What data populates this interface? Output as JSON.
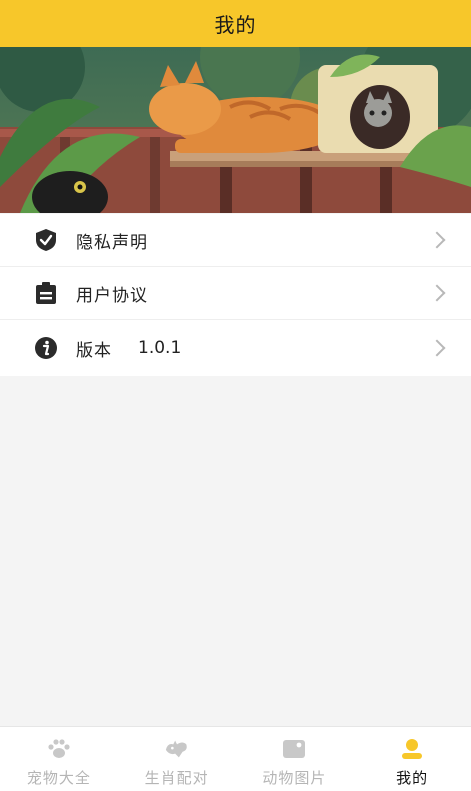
{
  "header": {
    "title": "我的"
  },
  "banner": {
    "alt": "cats-on-balcony-illustration"
  },
  "menu": {
    "items": [
      {
        "label": "隐私声明",
        "icon": "shield-check-icon"
      },
      {
        "label": "用户协议",
        "icon": "clipboard-icon"
      },
      {
        "label": "版本",
        "value": "1.0.1",
        "icon": "info-icon"
      }
    ]
  },
  "tabbar": {
    "tabs": [
      {
        "label": "宠物大全",
        "icon": "paw-icon",
        "active": false
      },
      {
        "label": "生肖配对",
        "icon": "zodiac-icon",
        "active": false
      },
      {
        "label": "动物图片",
        "icon": "picture-icon",
        "active": false
      },
      {
        "label": "我的",
        "icon": "user-icon",
        "active": true
      }
    ]
  },
  "colors": {
    "accent": "#f7c72a",
    "text": "#222222",
    "inactive_tab": "#b5b5b5",
    "chevron": "#b8b8b8"
  }
}
